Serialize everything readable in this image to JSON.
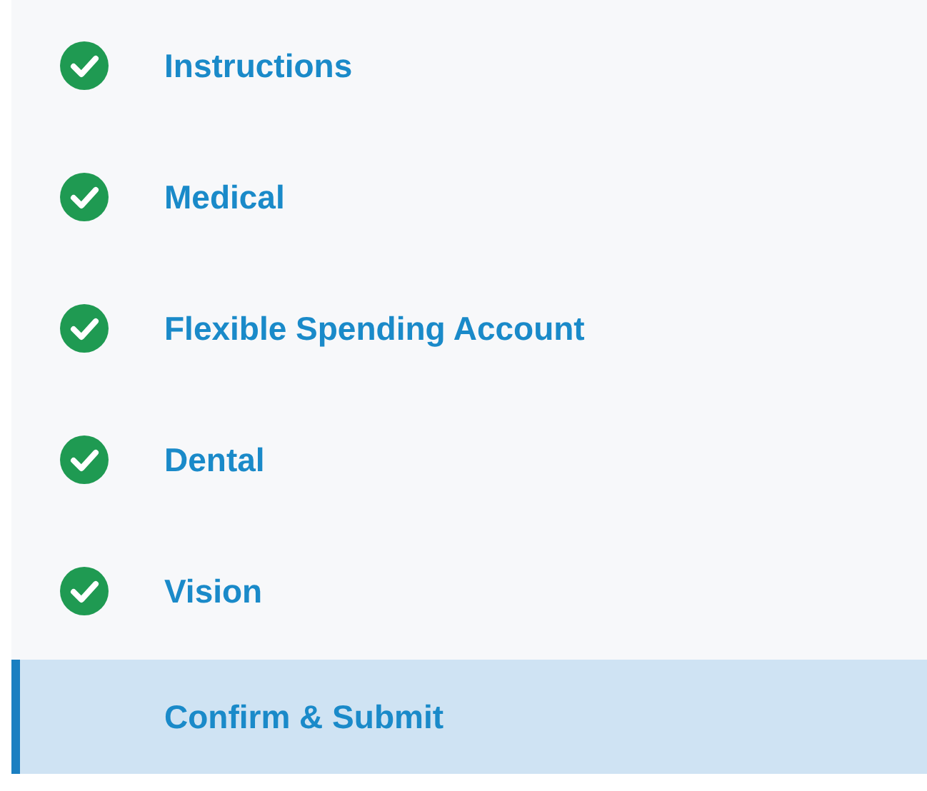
{
  "steps": [
    {
      "label": "Instructions",
      "completed": true,
      "selected": false
    },
    {
      "label": "Medical",
      "completed": true,
      "selected": false
    },
    {
      "label": "Flexible Spending Account",
      "completed": true,
      "selected": false
    },
    {
      "label": "Dental",
      "completed": true,
      "selected": false
    },
    {
      "label": "Vision",
      "completed": true,
      "selected": false
    },
    {
      "label": "Confirm & Submit",
      "completed": false,
      "selected": true
    }
  ]
}
